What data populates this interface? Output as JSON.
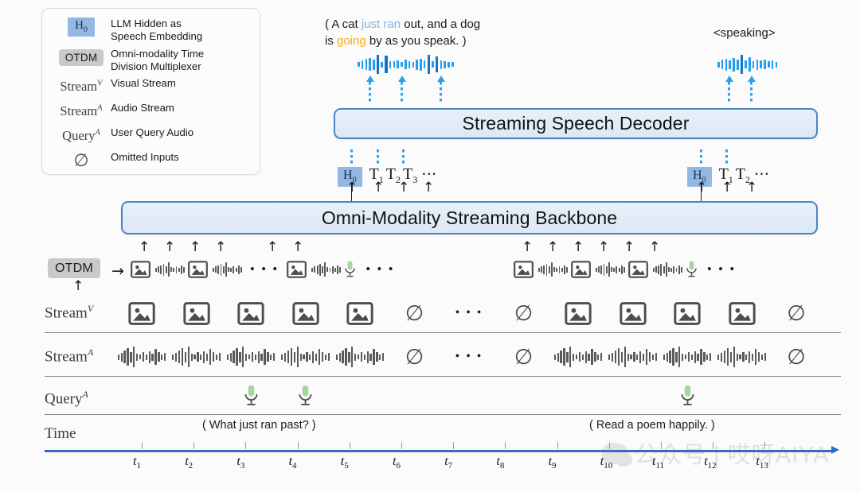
{
  "legend": {
    "items": [
      {
        "symbol": "H0",
        "symbol_kind": "badge-h0",
        "label": "LLM Hidden as\nSpeech Embedding"
      },
      {
        "symbol": "OTDM",
        "symbol_kind": "badge-otdm",
        "label": "Omni-modality Time\nDivision Multiplexer"
      },
      {
        "symbol": "Stream",
        "sup": "V",
        "symbol_kind": "math",
        "label": "Visual Stream"
      },
      {
        "symbol": "Stream",
        "sup": "A",
        "symbol_kind": "math",
        "label": "Audio Stream"
      },
      {
        "symbol": "Query",
        "sup": "A",
        "symbol_kind": "math",
        "label": "User Query Audio"
      },
      {
        "symbol": "∅",
        "symbol_kind": "null",
        "label": "Omitted Inputs"
      }
    ]
  },
  "output_left": {
    "line1_pre": "( A cat ",
    "line1_blue": "just ran",
    "line1_mid": " out, and a dog",
    "line2_pre": "is ",
    "line2_orange": "going",
    "line2_post": " by as you speak. )"
  },
  "output_right": {
    "text": "<speaking>"
  },
  "decoder": {
    "title": "Streaming Speech Decoder"
  },
  "backbone": {
    "title": "Omni-Modality Streaming Backbone"
  },
  "tokens_left": {
    "h0": "H",
    "h0_sub": "0",
    "items": [
      "T1",
      "T2",
      "T3"
    ],
    "ellipsis": "⋯"
  },
  "tokens_right": {
    "h0": "H",
    "h0_sub": "0",
    "items": [
      "T1",
      "T2"
    ],
    "ellipsis": "⋯"
  },
  "otdm": {
    "label": "OTDM",
    "arrow": "→",
    "ellipsis": "• • •"
  },
  "rows": {
    "stream_v": {
      "label": "Stream",
      "sup": "V"
    },
    "stream_a": {
      "label": "Stream",
      "sup": "A"
    },
    "query_a": {
      "label": "Query",
      "sup": "A"
    },
    "time": {
      "label": "Time"
    }
  },
  "queries": {
    "left": "( What just ran past? )",
    "right": "( Read a poem happily. )"
  },
  "timeline": {
    "ticks": [
      "t1",
      "t2",
      "t3",
      "t4",
      "t5",
      "t6",
      "t7",
      "t8",
      "t9",
      "t10",
      "t11",
      "t12",
      "t13"
    ],
    "tick_base": "t",
    "tick_subs": [
      "1",
      "2",
      "3",
      "4",
      "5",
      "6",
      "7",
      "8",
      "9",
      "10",
      "11",
      "12",
      "13"
    ]
  },
  "stream_v_cells": [
    "image",
    "image",
    "image",
    "image",
    "image",
    "null",
    "ellipsis",
    "null",
    "image",
    "image",
    "image",
    "image",
    "null"
  ],
  "stream_a_cells": [
    "audio",
    "audio",
    "audio",
    "audio",
    "audio",
    "null",
    "ellipsis",
    "null",
    "audio",
    "audio",
    "audio",
    "audio",
    "null"
  ],
  "query_cells": [
    "",
    "",
    "mic",
    "mic",
    "",
    "",
    "",
    "",
    "",
    "",
    "mic",
    "",
    ""
  ],
  "watermark": {
    "text": "公众号 | 哎呀AIYA"
  },
  "colors": {
    "accent_blue": "#4f84c4",
    "token_badge": "#93b8e4",
    "otdm_badge": "#c9c9c9",
    "wave_blue": "#22a0ef",
    "highlight_blue": "#7fb2e8",
    "highlight_orange": "#f5ab12",
    "timeline": "#2f6ec4",
    "mic_green": "#a5d6a0"
  }
}
